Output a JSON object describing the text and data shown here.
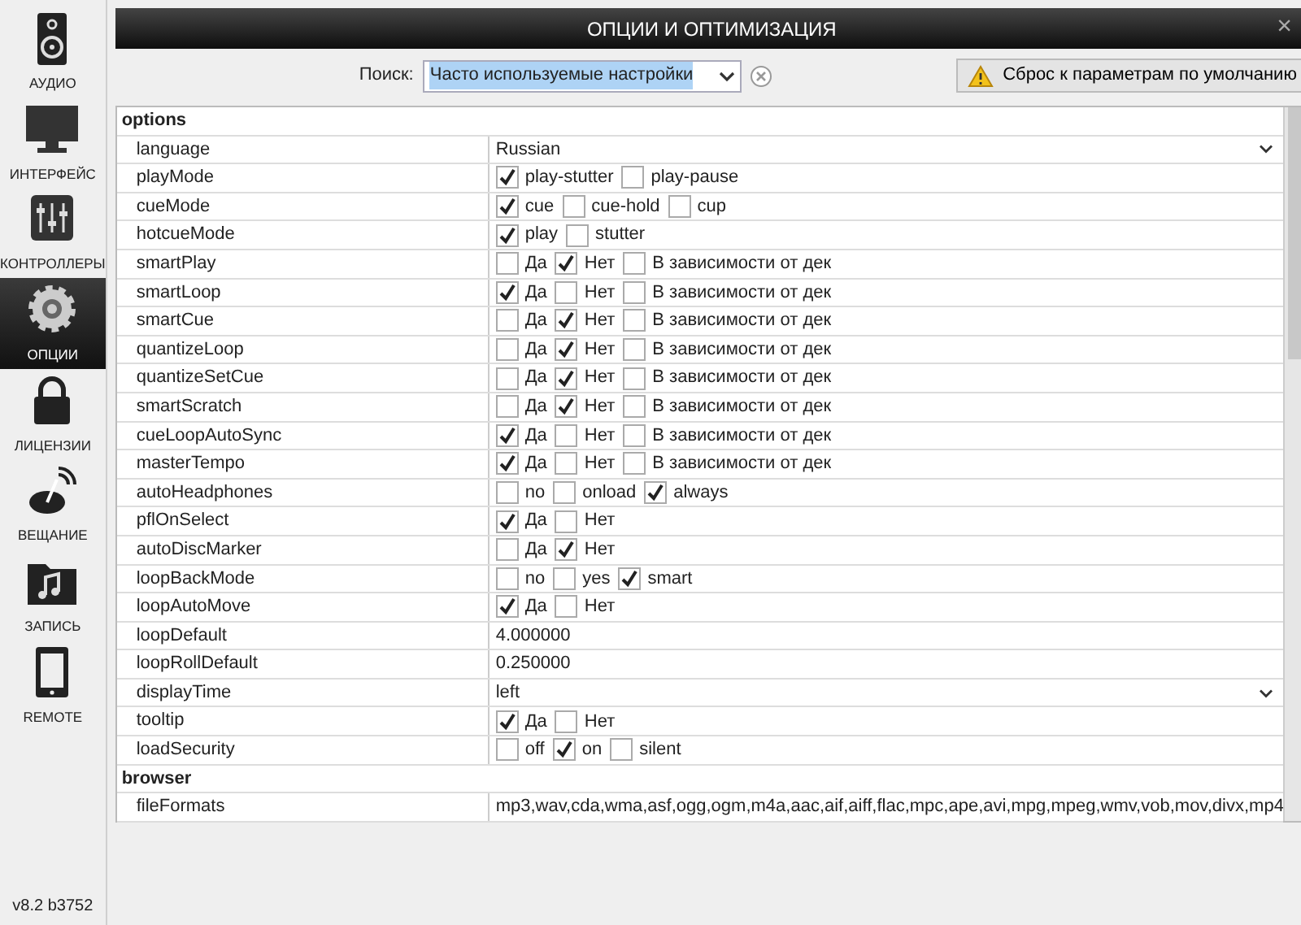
{
  "sidebar": {
    "items": [
      {
        "label": "АУДИО",
        "selected": false
      },
      {
        "label": "ИНТЕРФЕЙС",
        "selected": false
      },
      {
        "label": "КОНТРОЛЛЕРЫ",
        "selected": false
      },
      {
        "label": "ОПЦИИ",
        "selected": true
      },
      {
        "label": "ЛИЦЕНЗИИ",
        "selected": false
      },
      {
        "label": "ВЕЩАНИЕ",
        "selected": false
      },
      {
        "label": "ЗАПИСЬ",
        "selected": false
      },
      {
        "label": "REMOTE",
        "selected": false
      }
    ],
    "version": "v8.2 b3752"
  },
  "window": {
    "title": "ОПЦИИ И ОПТИМИЗАЦИЯ",
    "close": "×"
  },
  "search": {
    "label": "Поиск:",
    "value": "Часто используемые настройки"
  },
  "reset_button": "Сброс к параметрам по умолчанию",
  "table": {
    "rows": [
      {
        "kind": "group",
        "name": "options"
      },
      {
        "kind": "dropdown",
        "name": "language",
        "value": "Russian"
      },
      {
        "kind": "checks",
        "name": "playMode",
        "options": [
          {
            "label": "play-stutter",
            "checked": true
          },
          {
            "label": "play-pause",
            "checked": false
          }
        ]
      },
      {
        "kind": "checks",
        "name": "cueMode",
        "options": [
          {
            "label": "cue",
            "checked": true
          },
          {
            "label": "cue-hold",
            "checked": false
          },
          {
            "label": "cup",
            "checked": false
          }
        ]
      },
      {
        "kind": "checks",
        "name": "hotcueMode",
        "options": [
          {
            "label": "play",
            "checked": true
          },
          {
            "label": "stutter",
            "checked": false
          }
        ]
      },
      {
        "kind": "checks",
        "name": "smartPlay",
        "options": [
          {
            "label": "Да",
            "checked": false
          },
          {
            "label": "Нет",
            "checked": true
          },
          {
            "label": "В зависимости от дек",
            "checked": false
          }
        ]
      },
      {
        "kind": "checks",
        "name": "smartLoop",
        "options": [
          {
            "label": "Да",
            "checked": true
          },
          {
            "label": "Нет",
            "checked": false
          },
          {
            "label": "В зависимости от дек",
            "checked": false
          }
        ]
      },
      {
        "kind": "checks",
        "name": "smartCue",
        "options": [
          {
            "label": "Да",
            "checked": false
          },
          {
            "label": "Нет",
            "checked": true
          },
          {
            "label": "В зависимости от дек",
            "checked": false
          }
        ]
      },
      {
        "kind": "checks",
        "name": "quantizeLoop",
        "options": [
          {
            "label": "Да",
            "checked": false
          },
          {
            "label": "Нет",
            "checked": true
          },
          {
            "label": "В зависимости от дек",
            "checked": false
          }
        ]
      },
      {
        "kind": "checks",
        "name": "quantizeSetCue",
        "options": [
          {
            "label": "Да",
            "checked": false
          },
          {
            "label": "Нет",
            "checked": true
          },
          {
            "label": "В зависимости от дек",
            "checked": false
          }
        ]
      },
      {
        "kind": "checks",
        "name": "smartScratch",
        "options": [
          {
            "label": "Да",
            "checked": false
          },
          {
            "label": "Нет",
            "checked": true
          },
          {
            "label": "В зависимости от дек",
            "checked": false
          }
        ]
      },
      {
        "kind": "checks",
        "name": "cueLoopAutoSync",
        "options": [
          {
            "label": "Да",
            "checked": true
          },
          {
            "label": "Нет",
            "checked": false
          },
          {
            "label": "В зависимости от дек",
            "checked": false
          }
        ]
      },
      {
        "kind": "checks",
        "name": "masterTempo",
        "options": [
          {
            "label": "Да",
            "checked": true
          },
          {
            "label": "Нет",
            "checked": false
          },
          {
            "label": "В зависимости от дек",
            "checked": false
          }
        ]
      },
      {
        "kind": "checks",
        "name": "autoHeadphones",
        "options": [
          {
            "label": "no",
            "checked": false
          },
          {
            "label": "onload",
            "checked": false
          },
          {
            "label": "always",
            "checked": true
          }
        ]
      },
      {
        "kind": "checks",
        "name": "pflOnSelect",
        "options": [
          {
            "label": "Да",
            "checked": true
          },
          {
            "label": "Нет",
            "checked": false
          }
        ]
      },
      {
        "kind": "checks",
        "name": "autoDiscMarker",
        "options": [
          {
            "label": "Да",
            "checked": false
          },
          {
            "label": "Нет",
            "checked": true
          }
        ]
      },
      {
        "kind": "checks",
        "name": "loopBackMode",
        "options": [
          {
            "label": "no",
            "checked": false
          },
          {
            "label": "yes",
            "checked": false
          },
          {
            "label": "smart",
            "checked": true
          }
        ]
      },
      {
        "kind": "checks",
        "name": "loopAutoMove",
        "options": [
          {
            "label": "Да",
            "checked": true
          },
          {
            "label": "Нет",
            "checked": false
          }
        ]
      },
      {
        "kind": "text",
        "name": "loopDefault",
        "value": "4.000000"
      },
      {
        "kind": "text",
        "name": "loopRollDefault",
        "value": "0.250000"
      },
      {
        "kind": "dropdown",
        "name": "displayTime",
        "value": "left"
      },
      {
        "kind": "checks",
        "name": "tooltip",
        "options": [
          {
            "label": "Да",
            "checked": true
          },
          {
            "label": "Нет",
            "checked": false
          }
        ]
      },
      {
        "kind": "checks",
        "name": "loadSecurity",
        "options": [
          {
            "label": "off",
            "checked": false
          },
          {
            "label": "on",
            "checked": true
          },
          {
            "label": "silent",
            "checked": false
          }
        ]
      },
      {
        "kind": "group",
        "name": "browser"
      },
      {
        "kind": "text",
        "name": "fileFormats",
        "value": "mp3,wav,cda,wma,asf,ogg,ogm,m4a,aac,aif,aiff,flac,mpc,ape,avi,mpg,mpeg,wmv,vob,mov,divx,mp4"
      }
    ]
  }
}
